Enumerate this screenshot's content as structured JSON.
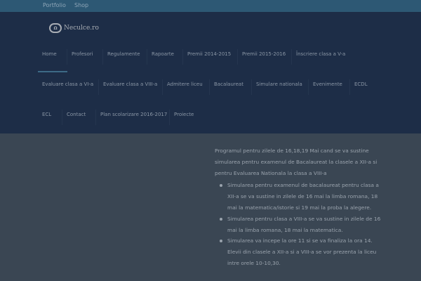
{
  "topbar": {
    "links": [
      "Portfolio",
      "Shop"
    ]
  },
  "logo": {
    "badge": "Ω",
    "name": "Neculce.ro"
  },
  "nav": {
    "row1": [
      "Home",
      "Profesori",
      "Regulamente",
      "Rapoarte",
      "Premii 2014-2015",
      "Premii 2015-2016",
      "Înscriere clasa a V-a"
    ],
    "row2": [
      "Evaluare clasa a VI-a",
      "Evaluare clasa a VIII-a",
      "Admitere liceu",
      "Bacalaureat",
      "Simulare nationala",
      "Evenimente",
      "ECDL"
    ],
    "row3": [
      "ECL",
      "Contact",
      "Plan scolarizare 2016-2017",
      "Proiecte"
    ]
  },
  "content": {
    "intro": "Programul pentru zilele de 16,18,19 Mai cand se va sustine simularea pentru examenul de Bacalaureat la clasele a XII-a si pentru Evaluarea Nationala la clasa a VIII-a",
    "bullets": [
      "Simularea pentru examenul de bacalaureat pentru clasa a XII-a se va sustine in zilele de 16 mai la limba romana, 18 mai la matematica/istorie si 19 mai la proba la alegere.",
      "Simularea pentru clasa a VIII-a se va sustine in zilele de 16 mai la limba romana, 18 mai la matematica.",
      "Simularea va incepe la ore 11 si se va finaliza la ora 14. Elevii din clasele a XII-a si a VIII-a se vor prezenta la liceu intre orele 10-10,30."
    ]
  }
}
